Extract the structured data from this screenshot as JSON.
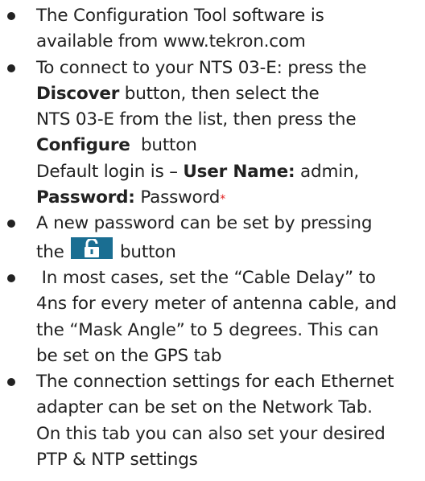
{
  "items": [
    {
      "lines": [
        {
          "text": "The Configuration Tool software is"
        },
        {
          "prefix": "available from ",
          "url": "www.tekron.com"
        }
      ]
    },
    {
      "lines": [
        {
          "text": "To connect to your NTS 03-E: press the"
        },
        {
          "bold": "Discover",
          "after": " button, then select the"
        },
        {
          "text": "NTS 03-E from the list, then press the"
        },
        {
          "bold": "Configure",
          "after": "  button"
        },
        {
          "before": "Default login is – ",
          "bold": "User Name:",
          "after": " admin,"
        },
        {
          "bold": "Password:",
          "after": " Password",
          "mark": "*"
        }
      ]
    },
    {
      "lines": [
        {
          "text": "A new password can be set by pressing"
        },
        {
          "before": "the ",
          "icon": "unlock-icon",
          "after": " button"
        }
      ]
    },
    {
      "lines": [
        {
          "text": " In most cases, set the “Cable Delay” to"
        },
        {
          "text": "4ns for every meter of antenna cable, and"
        },
        {
          "text": "the “Mask Angle” to 5 degrees. This can"
        },
        {
          "text": "be set on the GPS tab"
        }
      ]
    },
    {
      "lines": [
        {
          "text": "The connection settings for each Ethernet"
        },
        {
          "text": "adapter can be set on the Network Tab."
        },
        {
          "text": "On this tab you can also set your desired"
        },
        {
          "text": "PTP & NTP settings"
        }
      ]
    }
  ],
  "colors": {
    "text": "#222222",
    "asterisk": "#e21d1d",
    "icon_bg": "#1a6e92"
  }
}
